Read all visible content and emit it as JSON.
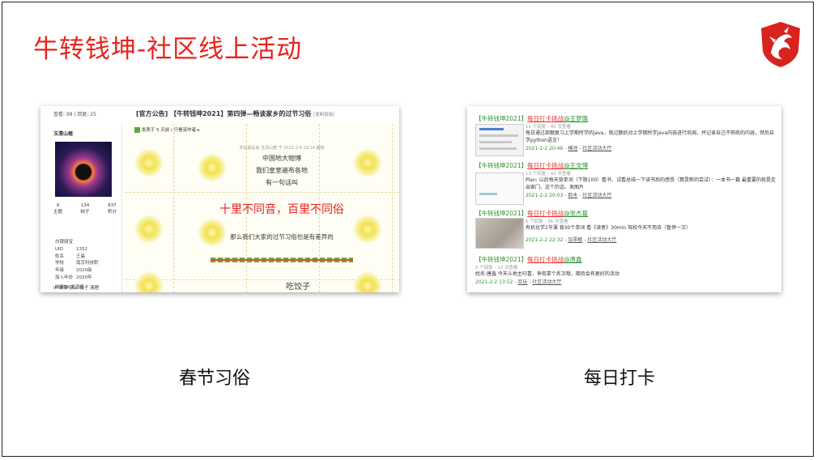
{
  "slide": {
    "title": "牛转钱坤-社区线上活动",
    "title_color": "#e8231c"
  },
  "captions": {
    "left": "春节习俗",
    "right": "每日打卡"
  },
  "left_shot": {
    "stats": "查看: 98  |  回复: 25",
    "post_title": "[官方公告] 【牛转钱坤2021】第四弹—畅谈家乡的过节习俗",
    "post_tag": "[复制链接]",
    "username": "玉清山楂",
    "numbers": [
      {
        "value": "9",
        "label": "主题"
      },
      {
        "value": "134",
        "label": "帖子"
      },
      {
        "value": "837",
        "label": "积分"
      }
    ],
    "rank": "白银骑宝",
    "info": [
      {
        "k": "UID",
        "v": "1352"
      },
      {
        "k": "姓名",
        "v": "王晨"
      },
      {
        "k": "学校",
        "v": "南京科技职"
      },
      {
        "k": "年级",
        "v": "2020级"
      },
      {
        "k": "加入年份",
        "v": "2020年"
      }
    ],
    "actions": "收听TA  发消息",
    "footer": "IP 编辑 禁止 帖子 清理",
    "post_bar": "发表于 5 天前  |  只看该作者  ▸",
    "edit_note": "本帖最后由 玉清山楂 于 2021-2-4 19:14 编辑",
    "lines": [
      "中国地大物博",
      "我们皇室遍布各地",
      "有一句话叫"
    ],
    "highlight": "十里不同音，百里不同俗",
    "line_after": "那么我们大家的过节习俗也是有差异的",
    "bottom": "吃饺子"
  },
  "right_shot": {
    "items": [
      {
        "prefix": "【牛转钱坤2021】",
        "link": "每日打卡挑战",
        "user": "@王梦璐",
        "meta": "11 个回复 - 40 次查看",
        "body": "每日通过部额复习上学期所学的java，就过额后对上学期所学java内容进行巩固，并记录自己不熟练的内容，然后自学python语言！",
        "date": "2021-2-2 20:46",
        "author": "横池",
        "board": "社区活动大厅"
      },
      {
        "prefix": "【牛转钱坤2021】",
        "link": "每日打卡挑战",
        "user": "@王文博",
        "meta": "13 个回复 - 43 次查看",
        "body": "Plan: 以后每天背单词（下限100）看书、试看总结一下读书后的感受（算是新的尝试）：一本书一篇 最重要的就是走出家门、这个的话、发图片",
        "date": "2021-2-2 20:03",
        "author": "韵木",
        "board": "社区活动大厅"
      },
      {
        "prefix": "【牛转钱坤2021】",
        "link": "每日打卡挑战",
        "user": "@张杰葛",
        "meta": "6 个回复 - 36 次查看",
        "body": "有机化学2节课 背30个单词 看《读者》30min 驾校今天不用去（暂停一次）",
        "date": "2021-2-2 22:32",
        "author": "加零敏",
        "board": "社区活动大厅"
      },
      {
        "prefix": "【牛转钱坤2021】",
        "link": "每日打卡挑战",
        "user": "@唐鑫",
        "meta": "5 个回复 - 22 次查看",
        "body": "姓名:唐鑫 今天斗地主叼喜，争取拿个名次哦，期待会有更好的活动",
        "date": "2021-2-2 13:52",
        "author": "欢玩",
        "board": "社区活动大厅"
      }
    ]
  }
}
